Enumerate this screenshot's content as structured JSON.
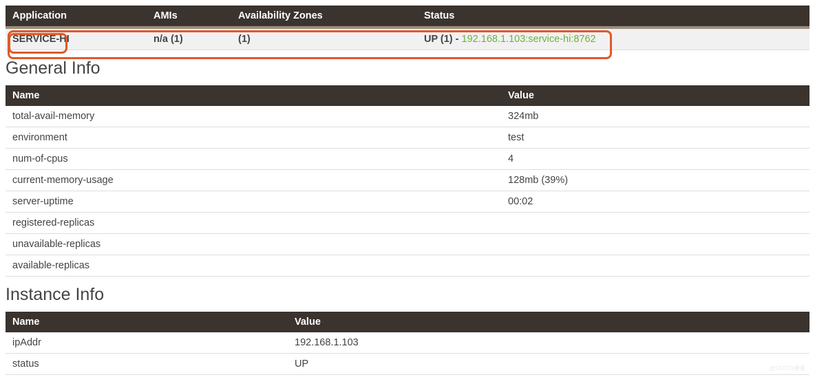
{
  "applications_table": {
    "headers": {
      "application": "Application",
      "amis": "AMIs",
      "azones": "Availability Zones",
      "status": "Status"
    },
    "rows": [
      {
        "application": "SERVICE-HI",
        "amis": "n/a (1)",
        "azones": "(1)",
        "status_prefix": "UP (1) - ",
        "status_link": "192.168.1.103:service-hi:8762"
      }
    ]
  },
  "general_info": {
    "heading": "General Info",
    "headers": {
      "name": "Name",
      "value": "Value"
    },
    "rows": [
      {
        "name": "total-avail-memory",
        "value": "324mb"
      },
      {
        "name": "environment",
        "value": "test"
      },
      {
        "name": "num-of-cpus",
        "value": "4"
      },
      {
        "name": "current-memory-usage",
        "value": "128mb (39%)"
      },
      {
        "name": "server-uptime",
        "value": "00:02"
      },
      {
        "name": "registered-replicas",
        "value": ""
      },
      {
        "name": "unavailable-replicas",
        "value": ""
      },
      {
        "name": "available-replicas",
        "value": ""
      }
    ]
  },
  "instance_info": {
    "heading": "Instance Info",
    "headers": {
      "name": "Name",
      "value": "Value"
    },
    "rows": [
      {
        "name": "ipAddr",
        "value": "192.168.1.103"
      },
      {
        "name": "status",
        "value": "UP"
      }
    ]
  }
}
